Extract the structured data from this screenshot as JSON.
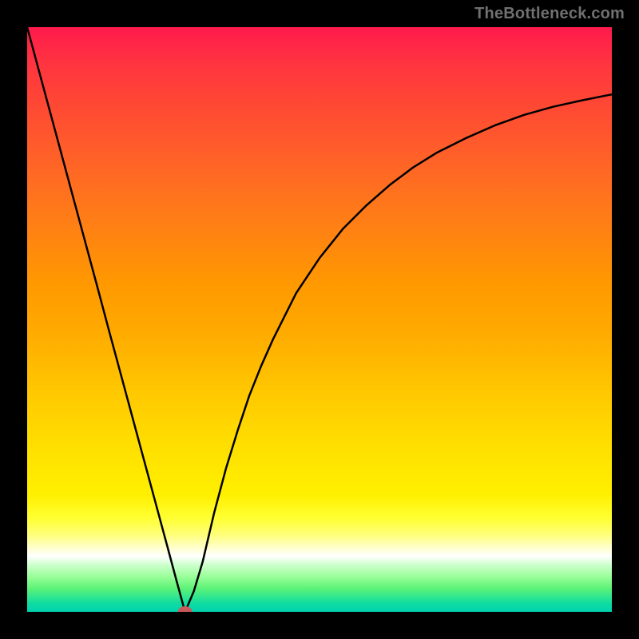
{
  "watermark": "TheBottleneck.com",
  "chart_data": {
    "type": "line",
    "title": "",
    "xlabel": "",
    "ylabel": "",
    "xlim": [
      0,
      100
    ],
    "ylim": [
      0,
      100
    ],
    "grid": false,
    "axes_visible": false,
    "background": "vertical-gradient red-to-green",
    "marker": {
      "x": 27,
      "y": 0,
      "color": "#c85a5a"
    },
    "series": [
      {
        "name": "curve",
        "color": "#000000",
        "x": [
          0,
          2,
          4,
          6,
          8,
          10,
          12,
          14,
          16,
          18,
          20,
          22,
          24,
          25.5,
          27,
          28.5,
          30,
          32,
          34,
          36,
          38,
          40,
          42,
          46,
          50,
          54,
          58,
          62,
          66,
          70,
          75,
          80,
          85,
          90,
          95,
          100
        ],
        "y": [
          100,
          92.6,
          85.2,
          77.8,
          70.4,
          63.0,
          55.6,
          48.1,
          40.7,
          33.3,
          25.9,
          18.5,
          11.1,
          5.5,
          0,
          3.5,
          8.5,
          17,
          24.5,
          31,
          37,
          42,
          46.5,
          54.5,
          60.5,
          65.5,
          69.5,
          73,
          76,
          78.5,
          81,
          83.2,
          85,
          86.4,
          87.5,
          88.5
        ]
      }
    ]
  }
}
